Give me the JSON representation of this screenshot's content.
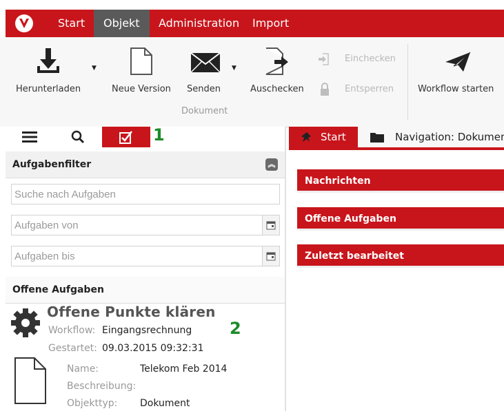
{
  "menu": {
    "items": [
      {
        "label": "Start"
      },
      {
        "label": "Objekt"
      },
      {
        "label": "Administration"
      },
      {
        "label": "Import"
      }
    ],
    "active_index": 1
  },
  "ribbon": {
    "download": "Herunterladen",
    "new_version": "Neue Version",
    "send": "Senden",
    "checkout": "Auschecken",
    "checkin": "Einchecken",
    "unlock": "Entsperren",
    "workflow": "Workflow starten",
    "group_label": "Dokument"
  },
  "left_panel": {
    "markers": {
      "one": "1",
      "two": "2"
    },
    "filter_header": "Aufgabenfilter",
    "search_placeholder": "Suche nach Aufgaben",
    "from_placeholder": "Aufgaben von",
    "to_placeholder": "Aufgaben bis",
    "open_tasks_header": "Offene Aufgaben",
    "task": {
      "title": "Offene Punkte klären",
      "workflow_label": "Workflow:",
      "workflow_value": "Eingangsrechnung",
      "started_label": "Gestartet:",
      "started_value": "09.03.2015 09:32:31",
      "name_label": "Name:",
      "name_value": "Telekom Feb 2014",
      "description_label": "Beschreibung:",
      "description_value": "",
      "type_label": "Objekttyp:",
      "type_value": "Dokument"
    }
  },
  "right_panel": {
    "tab_start": "Start",
    "tab_navigation": "Navigation: Dokumen",
    "panels": [
      "Nachrichten",
      "Offene Aufgaben",
      "Zuletzt bearbeitet"
    ]
  },
  "colors": {
    "brand_red": "#c8151b",
    "active_menu": "#5a5a5a",
    "marker_green": "#1a8c2a"
  }
}
